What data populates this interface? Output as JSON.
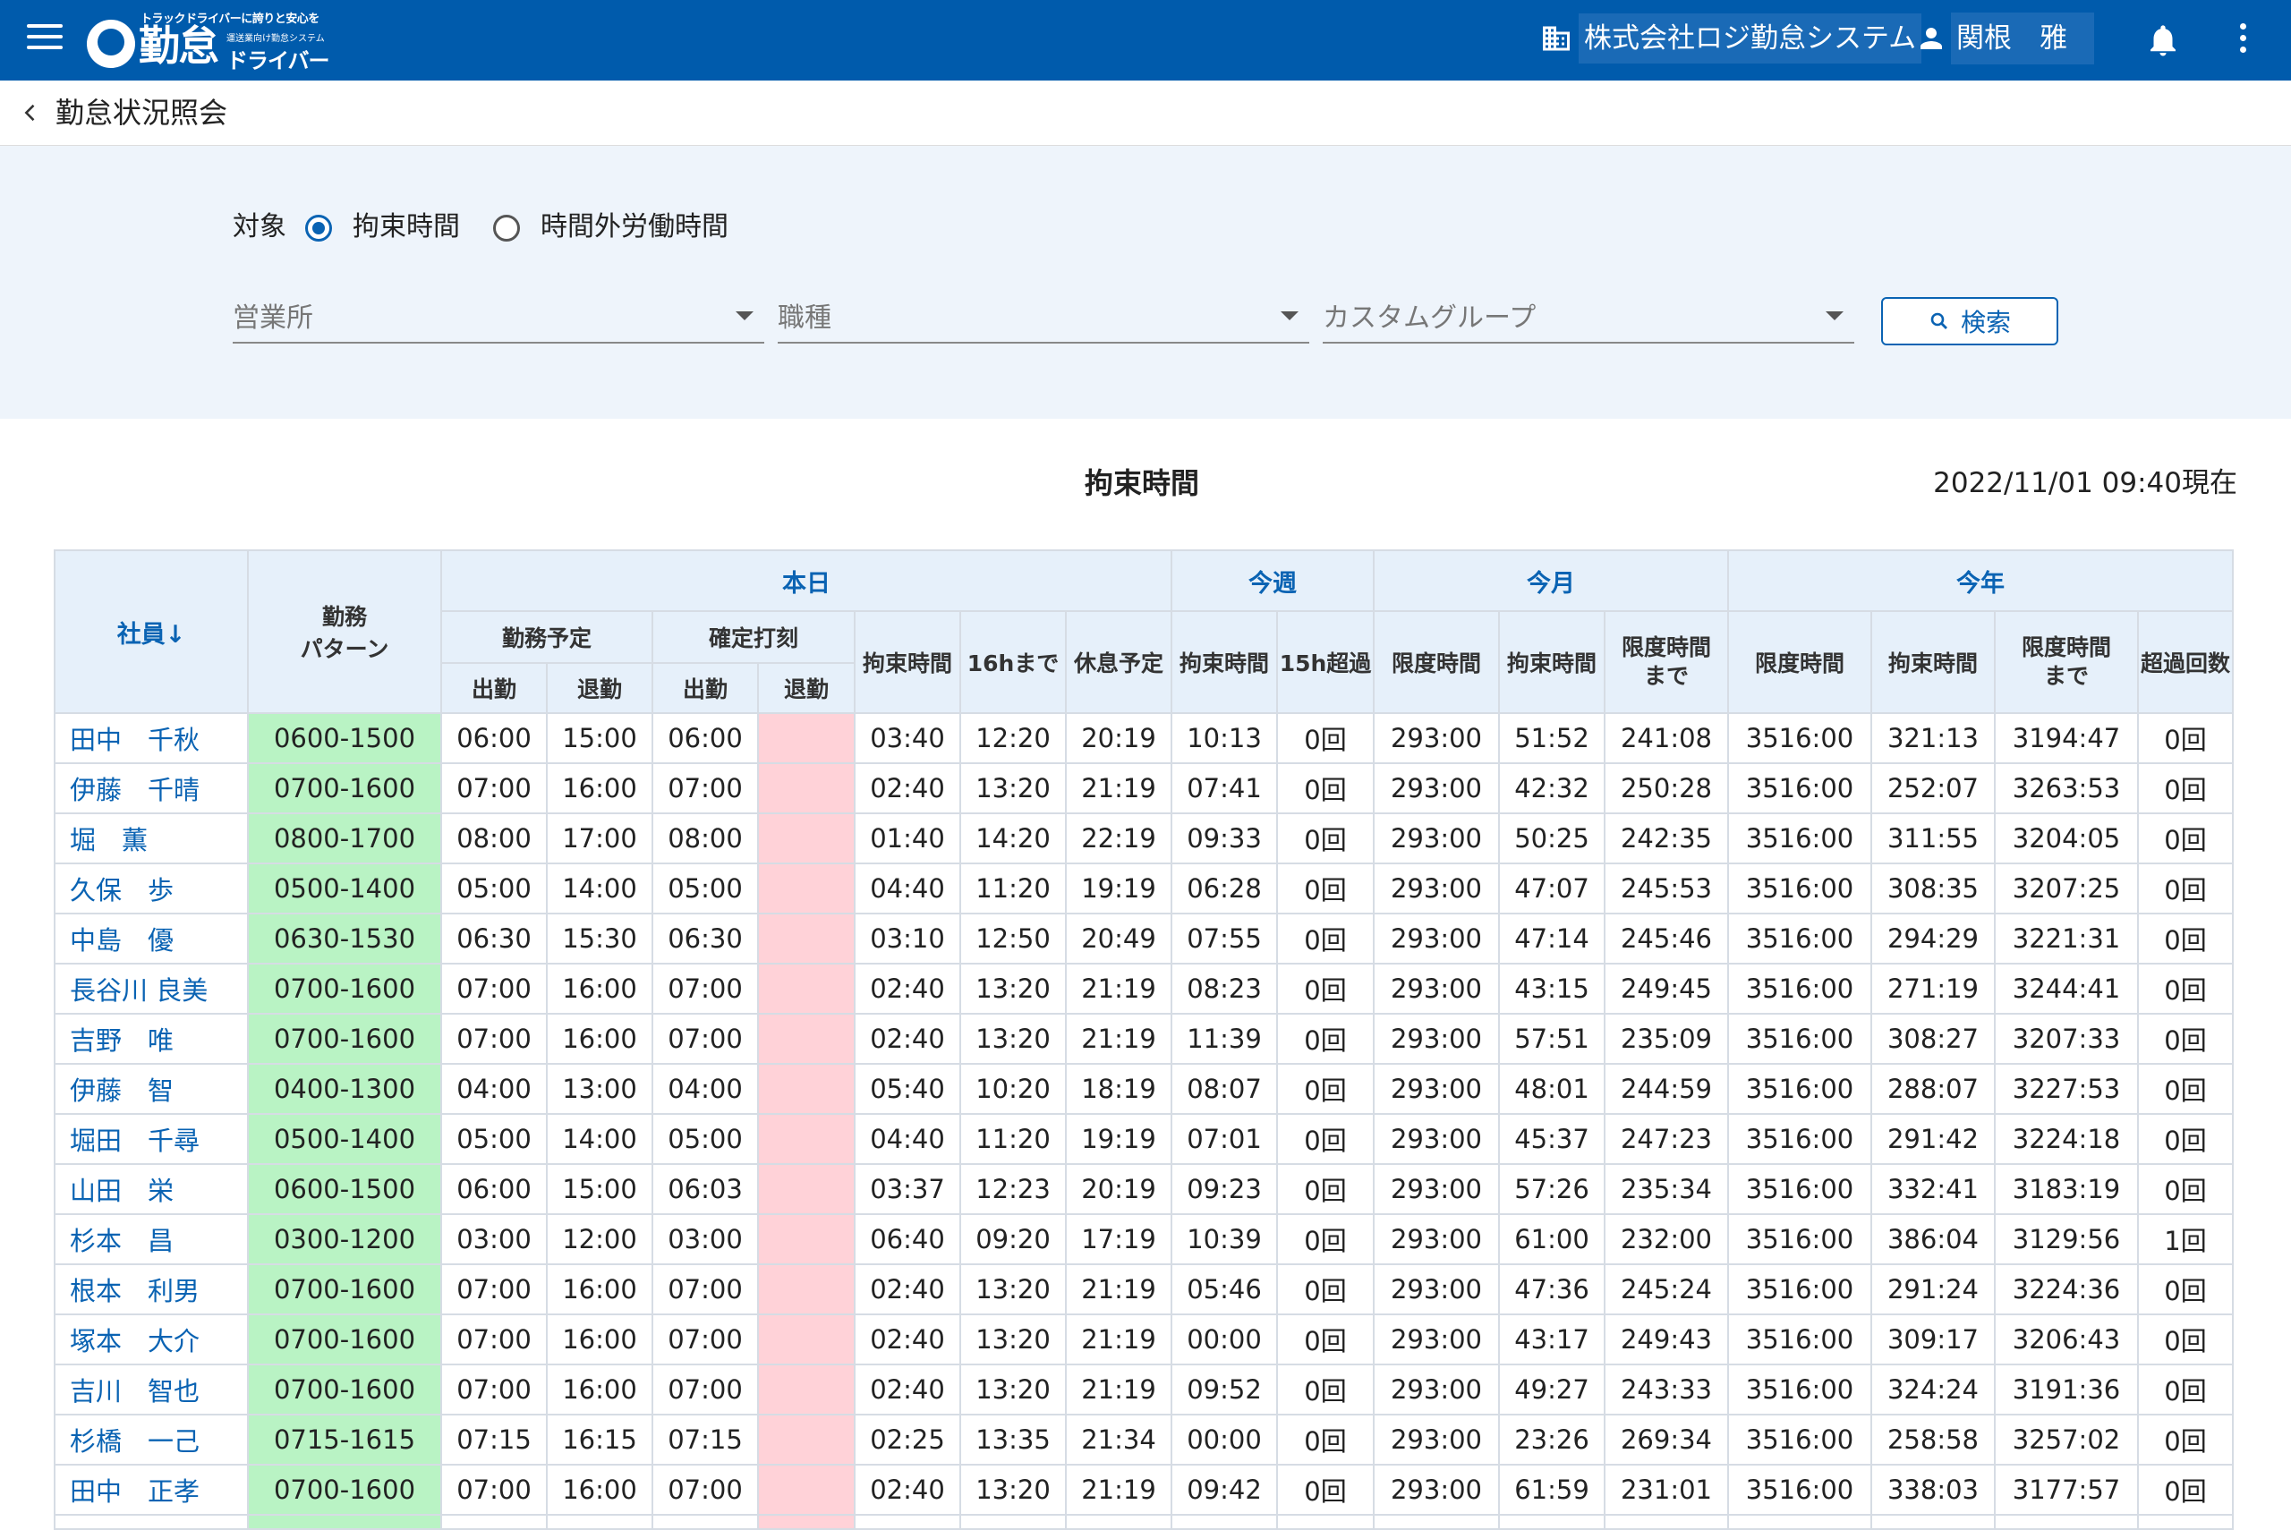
{
  "header": {
    "logo": {
      "tagline": "トラックドライバーに誇りと安心を",
      "main": "勤怠",
      "sub_small": "運送業向け勤怠システム",
      "sub": "ドライバー"
    },
    "company": "株式会社ロジ勤怠システム",
    "user": "関根　雅"
  },
  "breadcrumb": {
    "title": "勤怠状況照会"
  },
  "filters": {
    "target_label": "対象",
    "options": [
      "拘束時間",
      "時間外労働時間"
    ],
    "selected": "拘束時間",
    "office_placeholder": "営業所",
    "jobtype_placeholder": "職種",
    "group_placeholder": "カスタムグループ",
    "search_label": "検索"
  },
  "report": {
    "title": "拘束時間",
    "as_of": "2022/11/01 09:40現在"
  },
  "table": {
    "h": {
      "employee": "社員↓",
      "pattern": "勤務\nパターン",
      "today": "本日",
      "week": "今週",
      "month": "今月",
      "year": "今年",
      "schedule": "勤務予定",
      "punch": "確定打刻",
      "in": "出勤",
      "out": "退勤",
      "bind": "拘束時間",
      "until16": "16hまで",
      "rest": "休息予定",
      "over15": "15h超過",
      "limit": "限度時間",
      "until_limit": "限度時間\nまで",
      "exceed_count": "超過回数"
    },
    "rows": [
      [
        "田中　千秋",
        "0600-1500",
        "06:00",
        "15:00",
        "06:00",
        "",
        "03:40",
        "12:20",
        "20:19",
        "10:13",
        "0回",
        "293:00",
        "51:52",
        "241:08",
        "3516:00",
        "321:13",
        "3194:47",
        "0回"
      ],
      [
        "伊藤　千晴",
        "0700-1600",
        "07:00",
        "16:00",
        "07:00",
        "",
        "02:40",
        "13:20",
        "21:19",
        "07:41",
        "0回",
        "293:00",
        "42:32",
        "250:28",
        "3516:00",
        "252:07",
        "3263:53",
        "0回"
      ],
      [
        "堀　薫",
        "0800-1700",
        "08:00",
        "17:00",
        "08:00",
        "",
        "01:40",
        "14:20",
        "22:19",
        "09:33",
        "0回",
        "293:00",
        "50:25",
        "242:35",
        "3516:00",
        "311:55",
        "3204:05",
        "0回"
      ],
      [
        "久保　歩",
        "0500-1400",
        "05:00",
        "14:00",
        "05:00",
        "",
        "04:40",
        "11:20",
        "19:19",
        "06:28",
        "0回",
        "293:00",
        "47:07",
        "245:53",
        "3516:00",
        "308:35",
        "3207:25",
        "0回"
      ],
      [
        "中島　優",
        "0630-1530",
        "06:30",
        "15:30",
        "06:30",
        "",
        "03:10",
        "12:50",
        "20:49",
        "07:55",
        "0回",
        "293:00",
        "47:14",
        "245:46",
        "3516:00",
        "294:29",
        "3221:31",
        "0回"
      ],
      [
        "長谷川 良美",
        "0700-1600",
        "07:00",
        "16:00",
        "07:00",
        "",
        "02:40",
        "13:20",
        "21:19",
        "08:23",
        "0回",
        "293:00",
        "43:15",
        "249:45",
        "3516:00",
        "271:19",
        "3244:41",
        "0回"
      ],
      [
        "吉野　唯",
        "0700-1600",
        "07:00",
        "16:00",
        "07:00",
        "",
        "02:40",
        "13:20",
        "21:19",
        "11:39",
        "0回",
        "293:00",
        "57:51",
        "235:09",
        "3516:00",
        "308:27",
        "3207:33",
        "0回"
      ],
      [
        "伊藤　智",
        "0400-1300",
        "04:00",
        "13:00",
        "04:00",
        "",
        "05:40",
        "10:20",
        "18:19",
        "08:07",
        "0回",
        "293:00",
        "48:01",
        "244:59",
        "3516:00",
        "288:07",
        "3227:53",
        "0回"
      ],
      [
        "堀田　千尋",
        "0500-1400",
        "05:00",
        "14:00",
        "05:00",
        "",
        "04:40",
        "11:20",
        "19:19",
        "07:01",
        "0回",
        "293:00",
        "45:37",
        "247:23",
        "3516:00",
        "291:42",
        "3224:18",
        "0回"
      ],
      [
        "山田　栄",
        "0600-1500",
        "06:00",
        "15:00",
        "06:03",
        "",
        "03:37",
        "12:23",
        "20:19",
        "09:23",
        "0回",
        "293:00",
        "57:26",
        "235:34",
        "3516:00",
        "332:41",
        "3183:19",
        "0回"
      ],
      [
        "杉本　昌",
        "0300-1200",
        "03:00",
        "12:00",
        "03:00",
        "",
        "06:40",
        "09:20",
        "17:19",
        "10:39",
        "0回",
        "293:00",
        "61:00",
        "232:00",
        "3516:00",
        "386:04",
        "3129:56",
        "1回"
      ],
      [
        "根本　利男",
        "0700-1600",
        "07:00",
        "16:00",
        "07:00",
        "",
        "02:40",
        "13:20",
        "21:19",
        "05:46",
        "0回",
        "293:00",
        "47:36",
        "245:24",
        "3516:00",
        "291:24",
        "3224:36",
        "0回"
      ],
      [
        "塚本　大介",
        "0700-1600",
        "07:00",
        "16:00",
        "07:00",
        "",
        "02:40",
        "13:20",
        "21:19",
        "00:00",
        "0回",
        "293:00",
        "43:17",
        "249:43",
        "3516:00",
        "309:17",
        "3206:43",
        "0回"
      ],
      [
        "吉川　智也",
        "0700-1600",
        "07:00",
        "16:00",
        "07:00",
        "",
        "02:40",
        "13:20",
        "21:19",
        "09:52",
        "0回",
        "293:00",
        "49:27",
        "243:33",
        "3516:00",
        "324:24",
        "3191:36",
        "0回"
      ],
      [
        "杉橋　一己",
        "0715-1615",
        "07:15",
        "16:15",
        "07:15",
        "",
        "02:25",
        "13:35",
        "21:34",
        "00:00",
        "0回",
        "293:00",
        "23:26",
        "269:34",
        "3516:00",
        "258:58",
        "3257:02",
        "0回"
      ],
      [
        "田中　正孝",
        "0700-1600",
        "07:00",
        "16:00",
        "07:00",
        "",
        "02:40",
        "13:20",
        "21:19",
        "09:42",
        "0回",
        "293:00",
        "61:59",
        "231:01",
        "3516:00",
        "338:03",
        "3177:57",
        "0回"
      ]
    ]
  },
  "colors": {
    "appbar": "#005bac",
    "accent": "#0a63b3",
    "pattern_cell": "#b9f3c4",
    "missing_punch": "#ffd2d8",
    "panel": "#eef4fb"
  },
  "icons": [
    "menu-icon",
    "building-icon",
    "person-icon",
    "bell-icon",
    "more-vert-icon",
    "chevron-left-icon",
    "search-icon"
  ]
}
